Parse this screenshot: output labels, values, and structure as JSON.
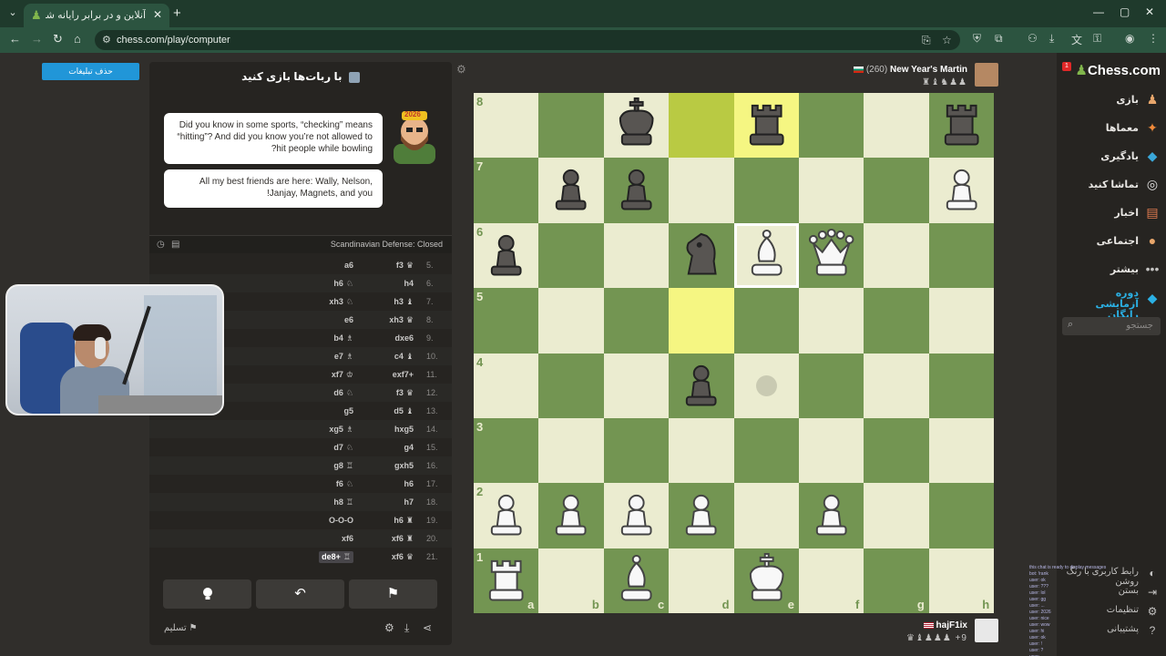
{
  "browser": {
    "tab_title": "آنلاین و در برابر رایانه شطرنج بازی",
    "url": "chess.com/play/computer"
  },
  "ads": {
    "remove_label": "حذف تبلیغات"
  },
  "panel": {
    "title": "با ربات‌ها بازی کنید",
    "bubble1": "Did you know in some sports, “checking” means “hitting”? And did you know you’re not allowed to hit people while bowling?",
    "bubble2": "All my best friends are here: Wally, Nelson, Janjay, Magnets, and you!",
    "bot_badge": "2026",
    "opening": "Scandinavian Defense: Closed",
    "resign_label": "تسلیم"
  },
  "moves": [
    {
      "num": "5.",
      "white": "f3",
      "wp": "♛",
      "black": "a6",
      "bp": ""
    },
    {
      "num": "6.",
      "white": "h4",
      "wp": "",
      "black": "h6",
      "bp": "♘"
    },
    {
      "num": "7.",
      "white": "h3",
      "wp": "♝",
      "black": "xh3",
      "bp": "♘"
    },
    {
      "num": "8.",
      "white": "xh3",
      "wp": "♛",
      "black": "e6",
      "bp": ""
    },
    {
      "num": "9.",
      "white": "dxe6",
      "wp": "",
      "black": "b4",
      "bp": "♗"
    },
    {
      "num": "10.",
      "white": "c4",
      "wp": "♝",
      "black": "e7",
      "bp": "♗"
    },
    {
      "num": "11.",
      "white": "exf7+",
      "wp": "",
      "black": "xf7",
      "bp": "♔"
    },
    {
      "num": "12.",
      "white": "f3",
      "wp": "♛",
      "black": "d6",
      "bp": "♘"
    },
    {
      "num": "13.",
      "white": "d5",
      "wp": "♝",
      "black": "g5",
      "bp": ""
    },
    {
      "num": "14.",
      "white": "hxg5",
      "wp": "",
      "black": "xg5",
      "bp": "♗"
    },
    {
      "num": "15.",
      "white": "g4",
      "wp": "",
      "black": "d7",
      "bp": "♘"
    },
    {
      "num": "16.",
      "white": "gxh5",
      "wp": "",
      "black": "g8",
      "bp": "♖"
    },
    {
      "num": "17.",
      "white": "h6",
      "wp": "",
      "black": "f6",
      "bp": "♘"
    },
    {
      "num": "18.",
      "white": "h7",
      "wp": "",
      "black": "h8",
      "bp": "♖"
    },
    {
      "num": "19.",
      "white": "h6",
      "wp": "♜",
      "black": "O-O-O",
      "bp": ""
    },
    {
      "num": "20.",
      "white": "xf6",
      "wp": "♜",
      "black": "xf6",
      "bp": ""
    },
    {
      "num": "21.",
      "white": "xf6",
      "wp": "♛",
      "black": "de8+",
      "bp": "♖"
    }
  ],
  "board": {
    "files": [
      "a",
      "b",
      "c",
      "d",
      "e",
      "f",
      "g",
      "h"
    ],
    "ranks": [
      "8",
      "7",
      "6",
      "5",
      "4",
      "3",
      "2",
      "1"
    ],
    "pieces": [
      {
        "sq": "c8",
        "p": "bK"
      },
      {
        "sq": "e8",
        "p": "bR"
      },
      {
        "sq": "h8",
        "p": "bR"
      },
      {
        "sq": "b7",
        "p": "bP"
      },
      {
        "sq": "c7",
        "p": "bP"
      },
      {
        "sq": "h7",
        "p": "wP"
      },
      {
        "sq": "a6",
        "p": "bP"
      },
      {
        "sq": "d6",
        "p": "bN"
      },
      {
        "sq": "e6",
        "p": "wB"
      },
      {
        "sq": "f6",
        "p": "wQ"
      },
      {
        "sq": "d4",
        "p": "bP"
      },
      {
        "sq": "a2",
        "p": "wP"
      },
      {
        "sq": "b2",
        "p": "wP"
      },
      {
        "sq": "c2",
        "p": "wP"
      },
      {
        "sq": "d2",
        "p": "wP"
      },
      {
        "sq": "f2",
        "p": "wP"
      },
      {
        "sq": "a1",
        "p": "wR"
      },
      {
        "sq": "c1",
        "p": "wB"
      },
      {
        "sq": "e1",
        "p": "wK"
      }
    ],
    "highlights": [
      "d8",
      "e8",
      "d5"
    ],
    "selected": "e6",
    "hints": [
      "e4"
    ]
  },
  "players": {
    "top_name": "New Year's Martin",
    "top_rating": "(260)",
    "top_captured": "♜♝♞♟♟",
    "bottom_name": "hajF1ix",
    "bottom_captured": "♛♝♟♟♟ +9"
  },
  "sidebar": {
    "logo": "Chess.com",
    "notif": "1",
    "items": [
      {
        "label": "بازی",
        "icon": "♟",
        "color": "#e8a66b"
      },
      {
        "label": "معماها",
        "icon": "✦",
        "color": "#f08a3a"
      },
      {
        "label": "یادگیری",
        "icon": "◆",
        "color": "#3aa7d9"
      },
      {
        "label": "تماشا کنید",
        "icon": "◎",
        "color": "#e0e0e0"
      },
      {
        "label": "اخبار",
        "icon": "▤",
        "color": "#e07a4f"
      },
      {
        "label": "اجتماعی",
        "icon": "●",
        "color": "#e8a66b"
      },
      {
        "label": "بیشتر",
        "icon": "•••",
        "color": "#c3c2c1"
      }
    ],
    "trial": "دوره آزمایشی رایگان",
    "search_placeholder": "جستجو",
    "bottom": [
      {
        "label": "رابط کاربری با رنگ روشن",
        "icon": "◐"
      },
      {
        "label": "بستن",
        "icon": "⇥"
      },
      {
        "label": "تنظیمات",
        "icon": "⚙"
      },
      {
        "label": "پشتیبانی",
        "icon": "?"
      }
    ]
  },
  "chat": [
    "this chat is ready to display messages",
    "bot: !rank",
    "user: ok",
    "user: ???",
    "user: lol",
    "user: gg",
    "user: ...",
    "user: 2026",
    "user: nice",
    "user: wow",
    "user: hi",
    "user: ok",
    "user: !",
    "user: ?",
    "user: ..."
  ]
}
